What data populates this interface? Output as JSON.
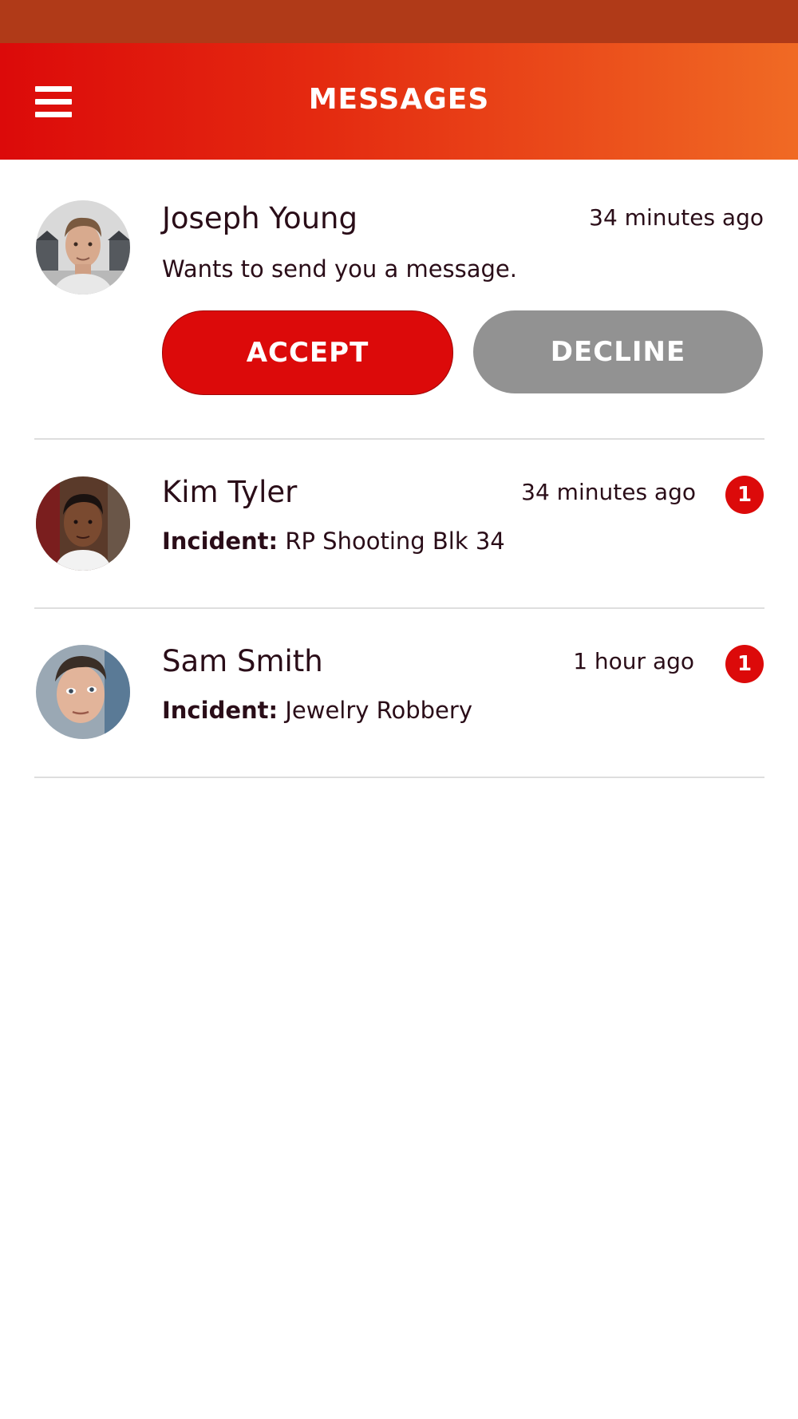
{
  "header": {
    "title": "MESSAGES",
    "menu_icon": "hamburger-menu-icon",
    "gradient_colors": [
      "#dc0a0a",
      "#f06a24"
    ]
  },
  "request": {
    "name": "Joseph Young",
    "time": "34 minutes ago",
    "message": "Wants to send you a message.",
    "accept_label": "ACCEPT",
    "decline_label": "DECLINE"
  },
  "conversations": [
    {
      "name": "Kim Tyler",
      "time": "34 minutes ago",
      "incident_label": "Incident:",
      "incident": "RP Shooting Blk 34",
      "unread": "1"
    },
    {
      "name": "Sam Smith",
      "time": "1 hour ago",
      "incident_label": "Incident:",
      "incident": "Jewelry Robbery",
      "unread": "1"
    }
  ],
  "colors": {
    "accent": "#dc0a0a",
    "decline": "#929292",
    "status_bar": "#b03a18"
  }
}
